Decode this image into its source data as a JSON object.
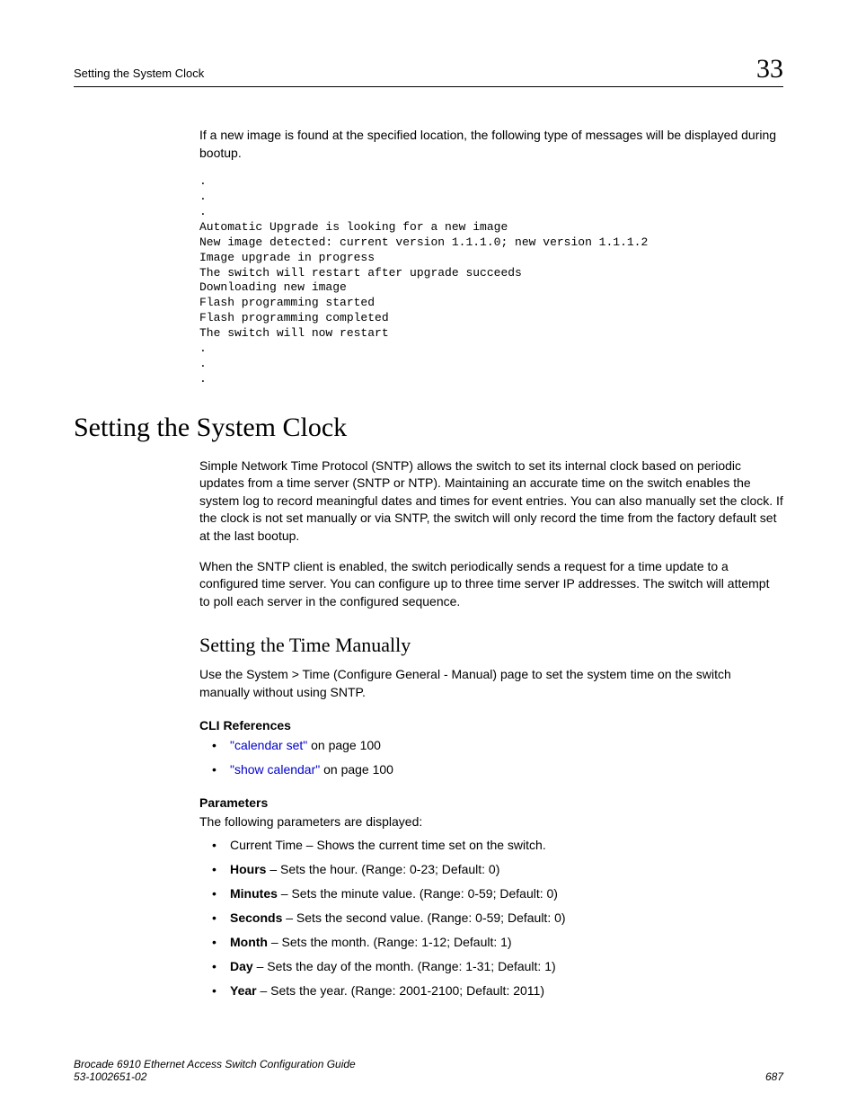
{
  "header": {
    "left": "Setting the System Clock",
    "chapter": "33"
  },
  "intro_para": "If a new image is found at the specified location, the following type of messages will be displayed during bootup.",
  "code_block": ".\n.\n.\nAutomatic Upgrade is looking for a new image\nNew image detected: current version 1.1.1.0; new version 1.1.1.2\nImage upgrade in progress\nThe switch will restart after upgrade succeeds\nDownloading new image\nFlash programming started\nFlash programming completed\nThe switch will now restart\n.\n.\n.",
  "section": {
    "title": "Setting the System Clock",
    "para1": "Simple Network Time Protocol (SNTP) allows the switch to set its internal clock based on periodic updates from a time server (SNTP or NTP). Maintaining an accurate time on the switch enables the system log to record meaningful dates and times for event entries. You can also manually set the clock. If the clock is not set manually or via SNTP, the switch will only record the time from the factory default set at the last bootup.",
    "para2": "When the SNTP client is enabled, the switch periodically sends a request for a time update to a configured time server. You can configure up to three time server IP addresses. The switch will attempt to poll each server in the configured sequence."
  },
  "subsection": {
    "title": "Setting the Time Manually",
    "para1": "Use the System > Time (Configure General - Manual) page to set the system time on the switch manually without using SNTP.",
    "cli_head": "CLI References",
    "cli_refs": [
      {
        "link": "\"calendar set\"",
        "suffix": " on page 100"
      },
      {
        "link": "\"show calendar\"",
        "suffix": " on page 100"
      }
    ],
    "params_head": "Parameters",
    "params_intro": "The following parameters are displayed:",
    "params": [
      {
        "bold": "",
        "text": "Current Time – Shows the current time set on the switch."
      },
      {
        "bold": "Hours",
        "text": " – Sets the hour. (Range: 0-23; Default: 0)"
      },
      {
        "bold": "Minutes",
        "text": " – Sets the minute value. (Range: 0-59; Default: 0)"
      },
      {
        "bold": "Seconds",
        "text": " – Sets the second value. (Range: 0-59; Default: 0)"
      },
      {
        "bold": "Month",
        "text": " – Sets the month. (Range: 1-12; Default: 1)"
      },
      {
        "bold": "Day",
        "text": " – Sets the day of the month. (Range: 1-31; Default: 1)"
      },
      {
        "bold": "Year",
        "text": " – Sets the year. (Range: 2001-2100; Default: 2011)"
      }
    ]
  },
  "footer": {
    "line1": "Brocade 6910 Ethernet Access Switch Configuration Guide",
    "line2": "53-1002651-02",
    "page": "687"
  }
}
